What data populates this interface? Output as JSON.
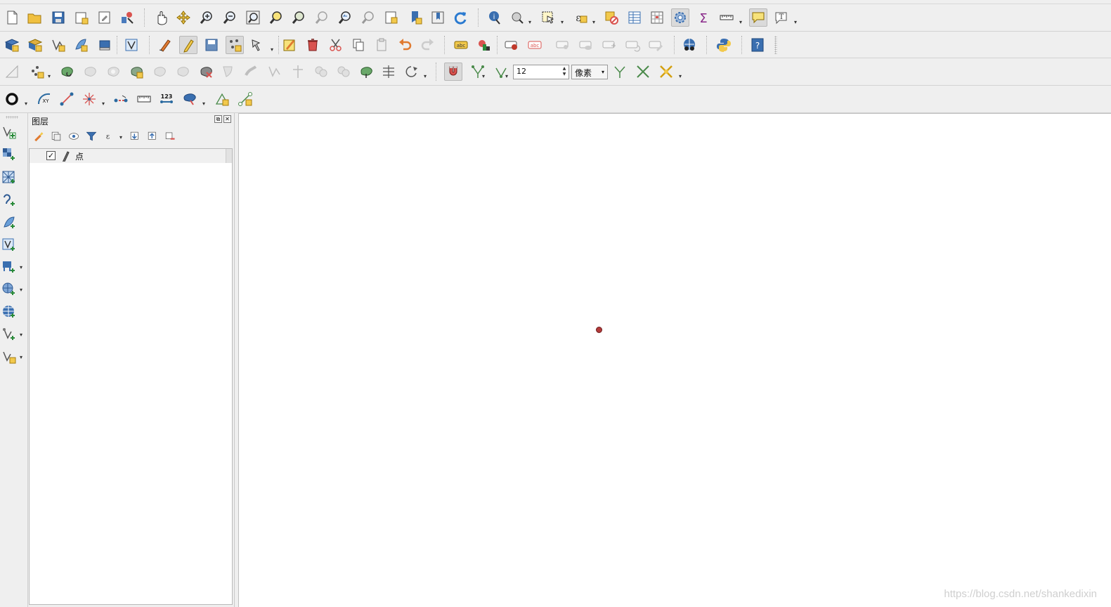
{
  "toolbar": {
    "snapping_tolerance": "12",
    "snapping_units": "像素"
  },
  "layers_panel": {
    "title": "图层",
    "layers": [
      {
        "name": "点",
        "checked": true,
        "check_mark": "✓"
      }
    ]
  },
  "map_canvas": {
    "point_color": "#b33a3a"
  },
  "watermark": "https://blog.csdn.net/shankedixin",
  "icons": {
    "text_tool_glyph": "T",
    "sigma_glyph": "Σ",
    "help_glyph": "?",
    "xy_label": "XY",
    "num_label": "123",
    "ab_label": "abc",
    "dropdown_glyph": "▾"
  }
}
